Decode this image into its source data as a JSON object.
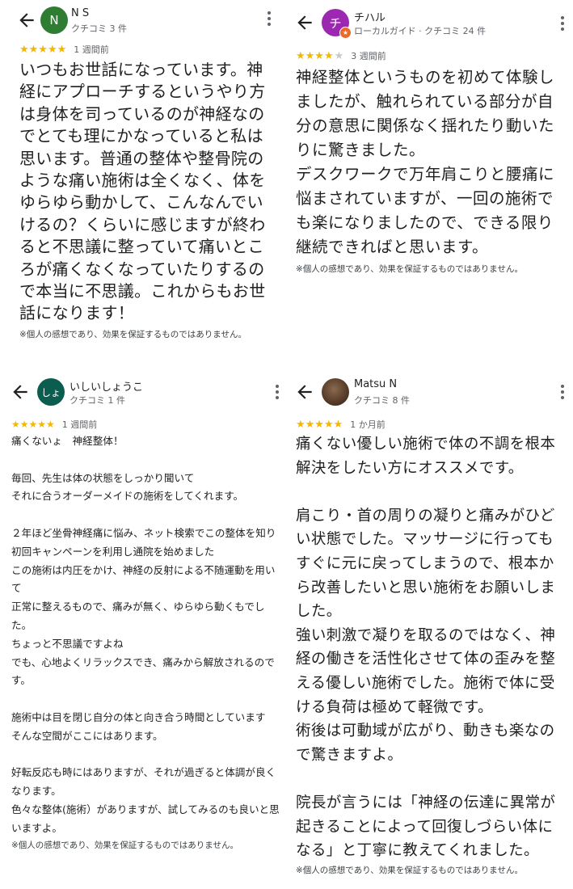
{
  "reviews": [
    {
      "reviewer": "N S",
      "meta": "クチコミ 3 件",
      "avatar_letter": "N",
      "avatar_color": "#2e7d32",
      "stars": 5,
      "time": "1 週間前",
      "text": "いつもお世話になっています。神経にアプローチするというやり方は身体を司っているのが神経なのでとても理にかなっていると私は思います。普通の整体や整骨院のような痛い施術は全くなく、体をゆらゆら動かして、こんなんでいけるの？くらいに感じますが終わると不思議に整っていて痛いところが痛くなくなっていたりするので本当に不思議。これからもお世話になります！",
      "disclaimer": "※個人の感想であり、効果を保証するものではありません。"
    },
    {
      "reviewer": "チハル",
      "meta": "ローカルガイド · クチコミ 24 件",
      "avatar_letter": "チ",
      "avatar_color": "#9c27b0",
      "stars": 4,
      "time": "3 週間前",
      "text": "神経整体というものを初めて体験しましたが、触れられている部分が自分の意思に関係なく揺れたり動いたりに驚きました。\nデスクワークで万年肩こりと腰痛に悩まされていますが、一回の施術でも楽になりましたので、できる限り継続できればと思います。",
      "disclaimer": "※個人の感想であり、効果を保証するものではありません。"
    },
    {
      "reviewer": "いしいしょうこ",
      "meta": "クチコミ 1 件",
      "avatar_letter": "しょ",
      "avatar_color": "#0b5d4f",
      "stars": 5,
      "time": "1 週間前",
      "text": "痛くないょ　神経整体！\n\n毎回、先生は体の状態をしっかり聞いて\nそれに合うオーダーメイドの施術をしてくれます。\n\n２年ほど坐骨神経痛に悩み、ネット検索でこの整体を知り\n初回キャンペーンを利用し通院を始めました\nこの施術は内圧をかけ、神経の反射による不随運動を用いて\n正常に整えるもので、痛みが無く、ゆらゆら動くもでした。\nちょっと不思議ですよね\nでも、心地よくリラックスでき、痛みから解放されるのです。\n\n施術中は目を閉じ自分の体と向き合う時間としています\nそんな空間がここにはあります。\n\n好転反応も時にはありますが、それが過ぎると体調が良くなります。\n色々な整体(施術）がありますが、試してみるのも良いと思いますよ。",
      "disclaimer": "※個人の感想であり、効果を保証するものではありません。"
    },
    {
      "reviewer": "Matsu N",
      "meta": "クチコミ 8 件",
      "avatar_letter": "",
      "avatar_color": "#5a3e2b",
      "stars": 5,
      "time": "1 か月前",
      "text": "痛くない優しい施術で体の不調を根本解決をしたい方にオススメです。\n\n肩こり・首の周りの凝りと痛みがひどい状態でした。マッサージに行ってもすぐに元に戻ってしまうので、根本から改善したいと思い施術をお願いしました。\n強い刺激で凝りを取るのではなく、神経の働きを活性化させて体の歪みを整える優しい施術でした。施術で体に受ける負荷は極めて軽微です。\n術後は可動域が広がり、動きも楽なので驚きますよ。\n\n院長が言うには「神経の伝達に異常が起きることによって回復しづらい体になる」と丁寧に教えてくれました。",
      "disclaimer": "※個人の感想であり、効果を保証するものではありません。"
    }
  ]
}
